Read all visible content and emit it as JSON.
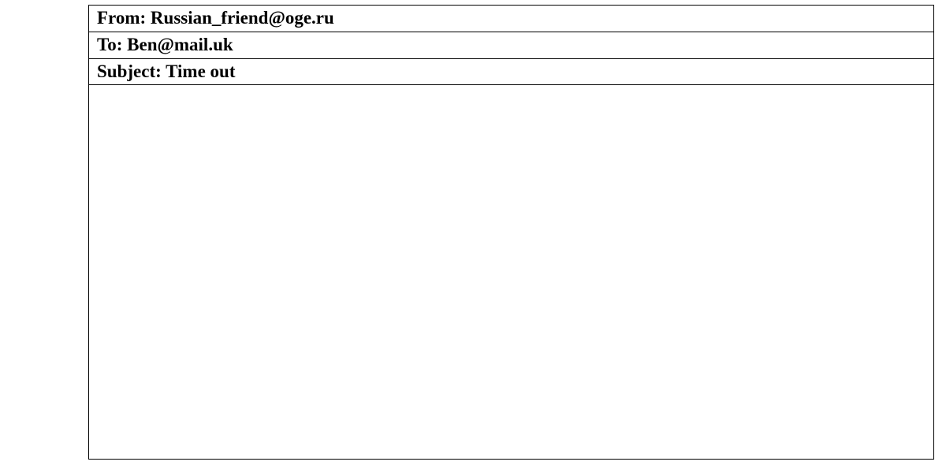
{
  "email": {
    "from_label": "From: ",
    "from_value": "Russian_friend@oge.ru",
    "to_label": "To: ",
    "to_value": "Ben@mail.uk",
    "subject_label": "Subject: ",
    "subject_value": "Time out",
    "body": ""
  }
}
